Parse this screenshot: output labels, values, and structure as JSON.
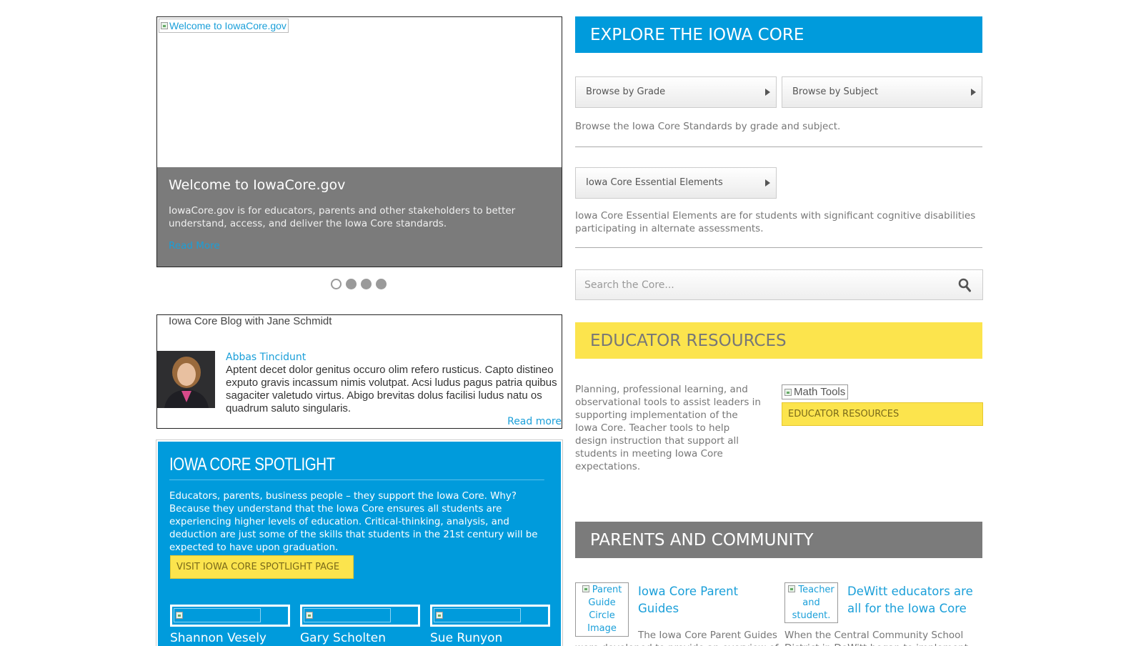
{
  "slider": {
    "image_alt": "Welcome to IowaCore.gov",
    "title": "Welcome to IowaCore.gov",
    "text": "IowaCore.gov is for educators, parents and other stakeholders to better understand, access, and deliver the Iowa Core standards.",
    "read_more": "Read More",
    "slide_count": 4,
    "active_slide": 1
  },
  "blog": {
    "title": "Iowa Core Blog with Jane Schmidt",
    "author": "Abbas Tincidunt",
    "excerpt": "Aptent decet dolor genitus occuro olim refero rusticus. Capto distineo exputo gravis incassum nimis volutpat. Acsi ludus pagus patria quibus sagaciter valetudo virtus. Abigo brevitas dolus facilisi ludus natu os quadrum saluto singularis.",
    "read_more": "Read more"
  },
  "spotlight": {
    "title": "IOWA CORE SPOTLIGHT",
    "text": "Educators, parents, business people – they support the Iowa Core. Why? Because they understand that the Iowa Core ensures all students are experiencing higher levels of education. Critical-thinking, analysis, and deduction are just some of the skills that students in the 21st century will be expected to have upon graduation.",
    "button": "VISIT IOWA CORE SPOTLIGHT PAGE",
    "people": [
      {
        "name": "Shannon Vesely"
      },
      {
        "name": "Gary Scholten"
      },
      {
        "name": "Sue Runyon"
      }
    ]
  },
  "explore": {
    "title": "EXPLORE THE IOWA CORE",
    "browse_grade": "Browse by Grade",
    "browse_subject": "Browse by Subject",
    "browse_desc": "Browse the Iowa Core Standards by grade and subject.",
    "essential_button": "Iowa Core Essential Elements",
    "essential_desc": "Iowa Core Essential Elements are for students with significant cognitive disabilities participating in alternate assessments."
  },
  "search": {
    "placeholder": "Search the Core..."
  },
  "educator": {
    "title": "EDUCATOR RESOURCES",
    "desc": "Planning, professional learning, and observational tools to assist leaders in supporting implementation of the Iowa Core. Teacher tools to help design instruction that support all students in meeting Iowa Core expectations.",
    "image_alt": "Math Tools",
    "button": "EDUCATOR RESOURCES"
  },
  "parents": {
    "title": "PARENTS AND COMMUNITY",
    "items": [
      {
        "image_alt": "Parent Guide Circle Image",
        "title": "Iowa Core Parent Guides",
        "text": "The Iowa Core Parent Guides were developed to provide an overview of"
      },
      {
        "image_alt": "Teacher and student.",
        "title": "DeWitt educators are all for the Iowa Core",
        "text": "When the Central Community School District in DeWitt began to implement"
      }
    ]
  },
  "colors": {
    "blue": "#009bdc",
    "yellow": "#fce44d",
    "gray": "#7b7b7b"
  }
}
